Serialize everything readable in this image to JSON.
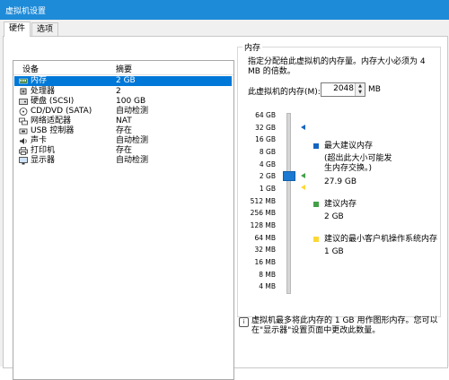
{
  "window": {
    "title": "虚拟机设置"
  },
  "tabs": [
    {
      "label": "硬件"
    },
    {
      "label": "选项"
    }
  ],
  "device_list": {
    "header_device": "设备",
    "header_summary": "摘要",
    "rows": [
      {
        "name": "内存",
        "value": "2 GB",
        "icon": "memory-icon",
        "selected": true
      },
      {
        "name": "处理器",
        "value": "2",
        "icon": "cpu-icon"
      },
      {
        "name": "硬盘 (SCSI)",
        "value": "100 GB",
        "icon": "hard-disk-icon"
      },
      {
        "name": "CD/DVD (SATA)",
        "value": "自动检测",
        "icon": "cd-dvd-icon"
      },
      {
        "name": "网络适配器",
        "value": "NAT",
        "icon": "network-adapter-icon"
      },
      {
        "name": "USB 控制器",
        "value": "存在",
        "icon": "usb-icon"
      },
      {
        "name": "声卡",
        "value": "自动检测",
        "icon": "sound-card-icon"
      },
      {
        "name": "打印机",
        "value": "存在",
        "icon": "printer-icon"
      },
      {
        "name": "显示器",
        "value": "自动检测",
        "icon": "display-icon"
      }
    ]
  },
  "memory": {
    "group_title": "内存",
    "description": "指定分配给此虚拟机的内存量。内存大小必须为 4 MB 的倍数。",
    "field_label": "此虚拟机的内存(M):",
    "value": "2048",
    "unit": "MB",
    "scale_labels": [
      "64 GB",
      "32 GB",
      "16 GB",
      "8 GB",
      "4 GB",
      "2 GB",
      "1 GB",
      "512 MB",
      "256 MB",
      "128 MB",
      "64 MB",
      "32 MB",
      "16 MB",
      "8 MB",
      "4 MB"
    ],
    "legend": [
      {
        "title": "最大建议内存",
        "note": "(超出此大小可能发生内存交换。)",
        "value": "27.9 GB",
        "color": "#1565c0"
      },
      {
        "title": "建议内存",
        "value": "2 GB",
        "color": "#43a047"
      },
      {
        "title": "建议的最小客户机操作系统内存",
        "value": "1 GB",
        "color": "#fdd835"
      }
    ]
  },
  "info_text": "虚拟机最多将此内存的 1 GB 用作图形内存。您可以在\"显示器\"设置页面中更改此数量。"
}
